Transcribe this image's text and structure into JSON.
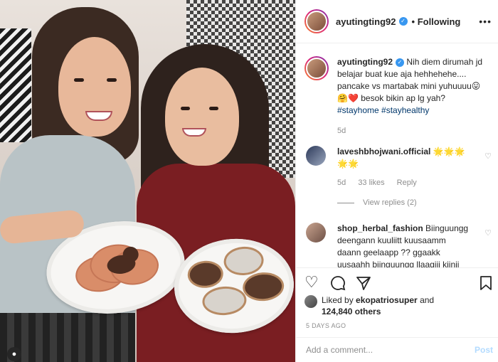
{
  "post": {
    "username": "ayutingting92",
    "follow_state": "Following",
    "caption_lines": [
      "Nih diem dirumah jd",
      "belajar buat kue aja hehhehehe....",
      "pancake vs martabak mini yuhuuuu😛",
      "🤗❤️ besok bikin ap lg yah?"
    ],
    "hashtags": [
      "#stayhome",
      "#stayhealthy"
    ],
    "caption_age": "5d"
  },
  "comments": [
    {
      "username": "laveshbhojwani.official",
      "text_line1": "🌟🌟🌟",
      "text_line2": "🌟🌟",
      "age": "5d",
      "likes": "33 likes",
      "reply": "Reply",
      "view_replies": "View replies (2)"
    },
    {
      "username": "shop_herbal_fashion",
      "text_line1": "Biinguungg",
      "text_line2": "deengann kuuliitt kuusaamm",
      "text_line3": "daann geelaapp ?? ggaakk",
      "text_line4": "uusaahh biinguungg llaagiii kiinii"
    }
  ],
  "likes": {
    "prefix": "Liked by ",
    "user": "ekopatriosuper",
    "middle": " and",
    "count": "124,840 others"
  },
  "date": "5 DAYS AGO",
  "add_comment": {
    "placeholder": "Add a comment...",
    "post_label": "Post"
  },
  "colors": {
    "link": "#00376b",
    "muted": "#8e8e8e",
    "verified": "#3897f0",
    "post_button": "#b3dbff"
  },
  "icons": [
    "more-icon",
    "verified-icon",
    "heart-icon",
    "comment-icon",
    "share-icon",
    "bookmark-icon",
    "user-tag-icon"
  ]
}
